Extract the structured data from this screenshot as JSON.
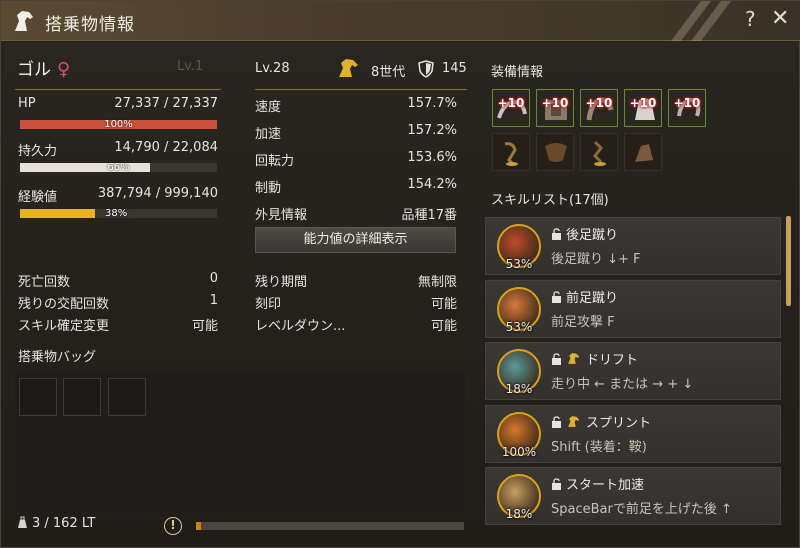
{
  "window": {
    "title": "搭乗物情報",
    "help": "?",
    "close": "✕"
  },
  "mount": {
    "name": "ゴル",
    "gender_symbol": "♀",
    "lv_ghost": "Lv.1",
    "level": "Lv.28",
    "generation": "8世代",
    "armor": "145"
  },
  "stats": {
    "hp": {
      "label": "HP",
      "value": "27,337 / 27,337",
      "pct": "100%",
      "fill": 1.0,
      "color": "#c8523a"
    },
    "stamina": {
      "label": "持久力",
      "value": "14,790 / 22,084",
      "pct": "66%",
      "fill": 0.66,
      "color": "#e6e2da"
    },
    "exp": {
      "label": "経験値",
      "value": "387,794 / 999,140",
      "pct": "38%",
      "fill": 0.38,
      "color": "#e6b420"
    }
  },
  "info": {
    "deaths": {
      "label": "死亡回数",
      "value": "0"
    },
    "breed": {
      "label": "残りの交配回数",
      "value": "1"
    },
    "skill_change": {
      "label": "スキル確定変更",
      "value": "可能"
    }
  },
  "attributes": [
    {
      "label": "速度",
      "value": "157.7%"
    },
    {
      "label": "加速",
      "value": "157.2%"
    },
    {
      "label": "回転力",
      "value": "153.6%"
    },
    {
      "label": "制動",
      "value": "154.2%"
    },
    {
      "label": "外見情報",
      "value": "品種17番"
    }
  ],
  "detail_button": "能力値の詳細表示",
  "lifespan": [
    {
      "label": "残り期間",
      "value": "無制限"
    },
    {
      "label": "刻印",
      "value": "可能"
    },
    {
      "label": "レベルダウン...",
      "value": "可能"
    }
  ],
  "bag": {
    "label": "搭乗物バッグ",
    "weight": "3 / 162 LT",
    "weight_fill": 0.02
  },
  "equipment": {
    "title": "装備情報",
    "enhanced": [
      "+10",
      "+10",
      "+10",
      "+10",
      "+10"
    ]
  },
  "skills": {
    "title": "スキルリスト(17個)",
    "items": [
      {
        "name": "後足蹴り",
        "desc": "後足蹴り ↓+ F",
        "pct": "53%",
        "horse_icon": false
      },
      {
        "name": "前足蹴り",
        "desc": "前足攻撃 F",
        "pct": "53%",
        "horse_icon": false
      },
      {
        "name": "ドリフト",
        "desc": "走り中 ← または → + ↓",
        "pct": "18%",
        "horse_icon": true
      },
      {
        "name": "スプリント",
        "desc": "Shift (装着：鞍)",
        "pct": "100%",
        "horse_icon": true
      },
      {
        "name": "スタート加速",
        "desc": "SpaceBarで前足を上げた後 ↑",
        "pct": "18%",
        "horse_icon": false
      }
    ]
  }
}
